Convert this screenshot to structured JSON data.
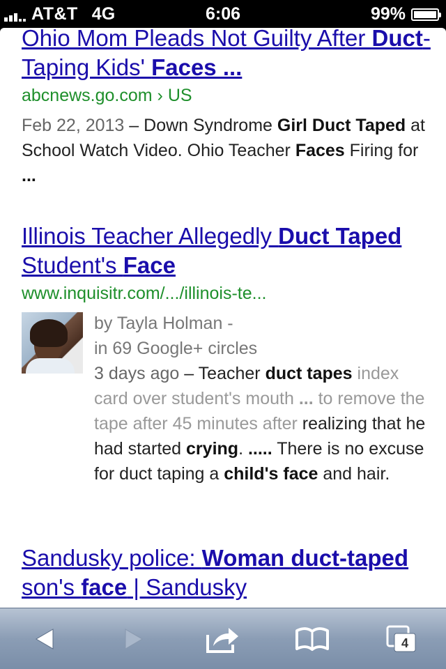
{
  "status": {
    "carrier": "AT&T",
    "network": "4G",
    "time": "6:06",
    "battery": "99%",
    "battery_level": 0.99
  },
  "results": [
    {
      "title_parts": [
        {
          "text": "Ohio Mom Pleads Not Guilty After ",
          "bold": false
        },
        {
          "text": "Duct",
          "bold": true
        },
        {
          "text": "-Taping Kids' ",
          "bold": false
        },
        {
          "text": "Faces ...",
          "bold": true
        }
      ],
      "url": "abcnews.go.com › US",
      "date": "Feb 22, 2013",
      "snippet_parts": [
        {
          "text": " – Down Syndrome ",
          "bold": false
        },
        {
          "text": "Girl Duct Taped",
          "bold": true
        },
        {
          "text": " at School Watch Video. Ohio Teacher ",
          "bold": false
        },
        {
          "text": "Faces",
          "bold": true
        },
        {
          "text": " Firing for ",
          "bold": false
        },
        {
          "text": "...",
          "bold": true
        }
      ]
    },
    {
      "title_parts": [
        {
          "text": "Illinois Teacher Allegedly ",
          "bold": false
        },
        {
          "text": "Duct Taped",
          "bold": true
        },
        {
          "text": " Student's ",
          "bold": false
        },
        {
          "text": "Face",
          "bold": true
        }
      ],
      "url": "www.inquisitr.com/.../illinois-te...",
      "byline": "by Tayla Holman -",
      "circles": "in 69 Google+ circles",
      "date": "3 days ago",
      "snippet_parts": [
        {
          "text": " – Teacher ",
          "bold": false
        },
        {
          "text": "duct tapes",
          "bold": true
        },
        {
          "text": " index card over student's mouth ",
          "bold": false,
          "faded": true
        },
        {
          "text": "...",
          "bold": true,
          "faded": true
        },
        {
          "text": " to remove the tape after 45 minutes after ",
          "bold": false,
          "faded": true
        },
        {
          "text": "realizing that he had started ",
          "bold": false
        },
        {
          "text": "crying",
          "bold": true
        },
        {
          "text": ". ",
          "bold": false
        },
        {
          "text": ".....",
          "bold": true
        },
        {
          "text": " There is no excuse for duct taping a ",
          "bold": false
        },
        {
          "text": "child's face",
          "bold": true
        },
        {
          "text": " and hair.",
          "bold": false
        }
      ]
    },
    {
      "title_parts": [
        {
          "text": "Sandusky police: ",
          "bold": false
        },
        {
          "text": "Woman duct-taped",
          "bold": true
        },
        {
          "text": " son's ",
          "bold": false
        },
        {
          "text": "face",
          "bold": true
        },
        {
          "text": " | Sandusky",
          "bold": false
        }
      ]
    }
  ],
  "toolbar": {
    "tab_count": "4",
    "icons": [
      "back-icon",
      "forward-icon",
      "share-icon",
      "bookmarks-icon",
      "tabs-icon"
    ]
  }
}
